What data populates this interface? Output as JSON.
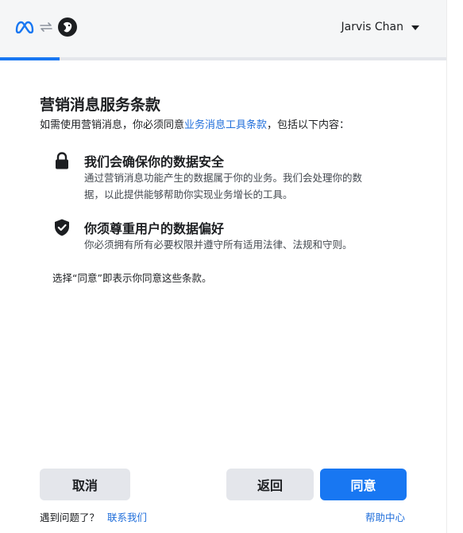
{
  "header": {
    "user_name": "Jarvis Chan",
    "icons": [
      "meta-logo-icon",
      "sync-arrows-icon",
      "app-avatar-icon",
      "caret-down-icon"
    ],
    "progress_fraction": 0.133
  },
  "content": {
    "title": "营销消息服务条款",
    "subtitle_before": "如需使用营销消息，你必须同意",
    "subtitle_link": "业务消息工具条款",
    "subtitle_after": "，包括以下内容：",
    "items": [
      {
        "icon": "lock-icon",
        "heading": "我们会确保你的数据安全",
        "body_line1": "通过营销消息功能产生的数据属于你的业务。我们会处理你的数",
        "body_line2": "据，以此提供能够帮助你实现业务增长的工具。"
      },
      {
        "icon": "shield-check-icon",
        "heading": "你须尊重用户的数据偏好",
        "body_line1": "你必须拥有所有必要权限并遵守所有适用法律、法规和守则。",
        "body_line2": ""
      }
    ],
    "agree_note": "选择“同意”即表示你同意这些条款。"
  },
  "actions": {
    "cancel_label": "取消",
    "back_label": "返回",
    "agree_label": "同意"
  },
  "footer": {
    "question_text": "遇到问题了？",
    "contact_link": "联系我们",
    "help_link": "帮助中心"
  },
  "colors": {
    "accent": "#1877f2",
    "link": "#216fdb",
    "header_bg": "#f5f6f7",
    "button_grey": "#e4e6eb"
  }
}
